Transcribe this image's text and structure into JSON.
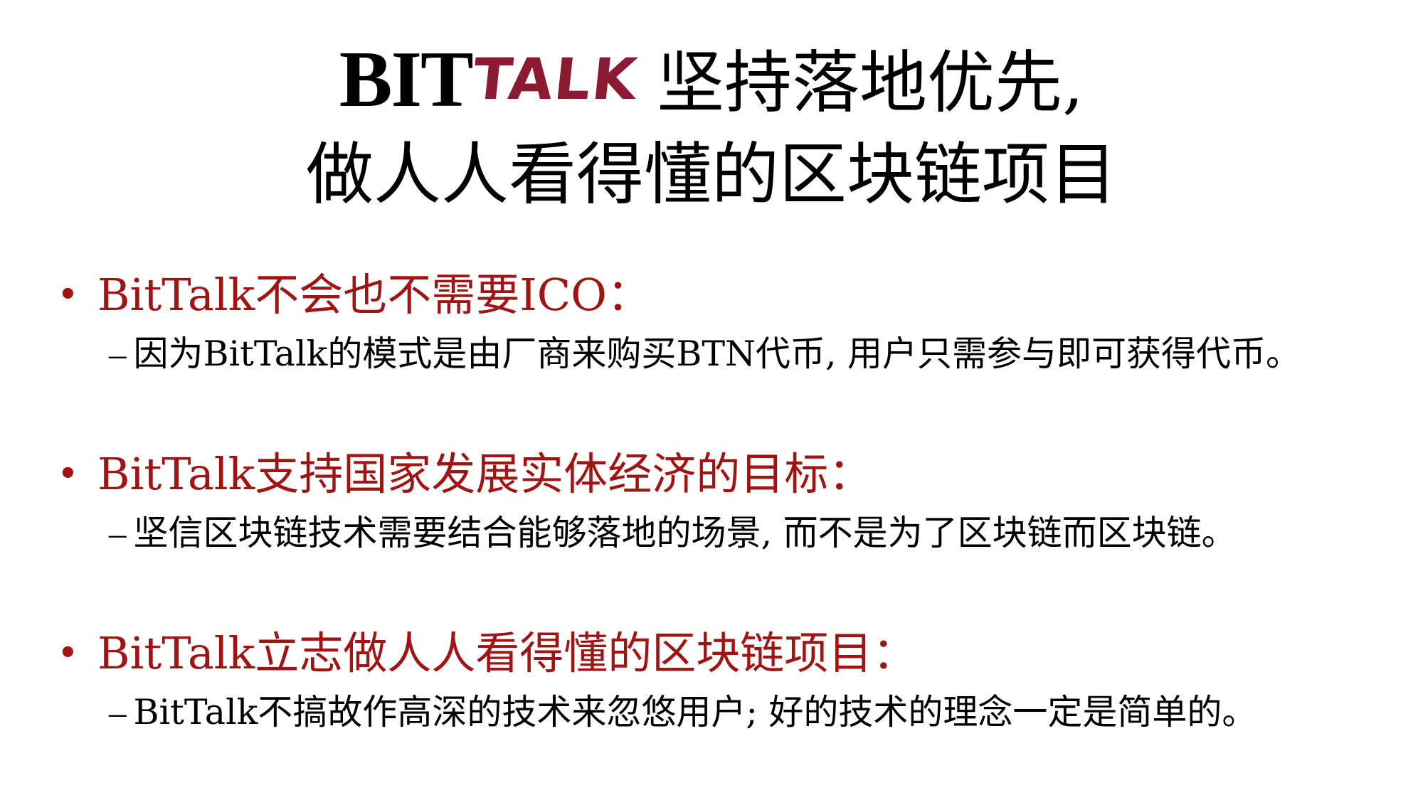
{
  "logo": {
    "bit": "BIT",
    "talk": "TALK"
  },
  "title": {
    "line1_text": "坚持落地优先,",
    "line2_text": "做人人看得懂的区块链项目"
  },
  "colors": {
    "logo_accent": "#8b1a32",
    "heading": "#a01414",
    "body": "#000000"
  },
  "points": [
    {
      "bullet": "•",
      "heading": "BitTalk不会也不需要ICO：",
      "dash": "–",
      "detail": "因为BitTalk的模式是由厂商来购买BTN代币, 用户只需参与即可获得代币。"
    },
    {
      "bullet": "•",
      "heading": "BitTalk支持国家发展实体经济的目标：",
      "dash": "–",
      "detail": "坚信区块链技术需要结合能够落地的场景, 而不是为了区块链而区块链。"
    },
    {
      "bullet": "•",
      "heading": "BitTalk立志做人人看得懂的区块链项目：",
      "dash": "–",
      "detail": "BitTalk不搞故作高深的技术来忽悠用户; 好的技术的理念一定是简单的。"
    }
  ]
}
